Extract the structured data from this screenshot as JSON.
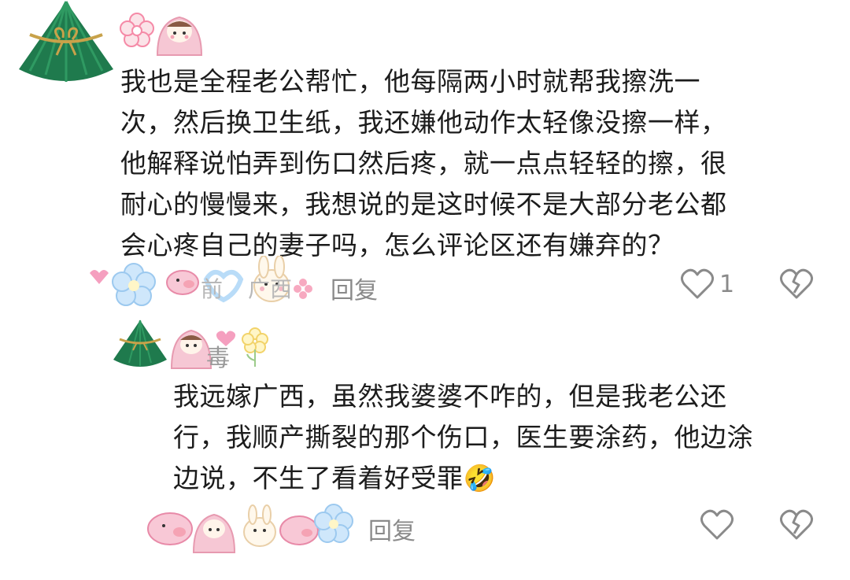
{
  "colors": {
    "text": "#1c1c1c",
    "muted": "#8a8a8a",
    "accent_pink": "#f7a9c0",
    "accent_blue": "#a9d3f5",
    "avatar_green": "#1f7a4d"
  },
  "comment": {
    "username": "",
    "text_lines": [
      "我也是全程老公帮忙，他每隔两小时就帮我擦洗一",
      "次，然后换卫生纸，我还嫌他动作太轻像没擦一样，",
      "他解释说怕弄到伤口然后疼，就一点点轻轻的擦，很",
      "耐心的慢慢来，我想说的是这时候不是大部分老公都",
      "会心疼自己的妻子吗，怎么评论区还有嫌弃的？"
    ],
    "reply_label": "回复",
    "like_count": "1",
    "icons": {
      "like": "heart-icon",
      "dislike": "broken-heart-icon"
    }
  },
  "reply": {
    "username_partial": "毒",
    "text_lines": [
      "我远嫁广西，虽然我婆婆不咋的，但是我老公还",
      "行，我顺产撕裂的那个伤口，医生要涂药，他边涂",
      "边说，不生了看着好受罪"
    ],
    "emoji": "🤣",
    "reply_label": "回复",
    "icons": {
      "like": "heart-icon",
      "dislike": "broken-heart-icon"
    }
  },
  "meta_partial": {
    "comment_time_fragment": "前",
    "comment_location_fragment": "广西"
  }
}
